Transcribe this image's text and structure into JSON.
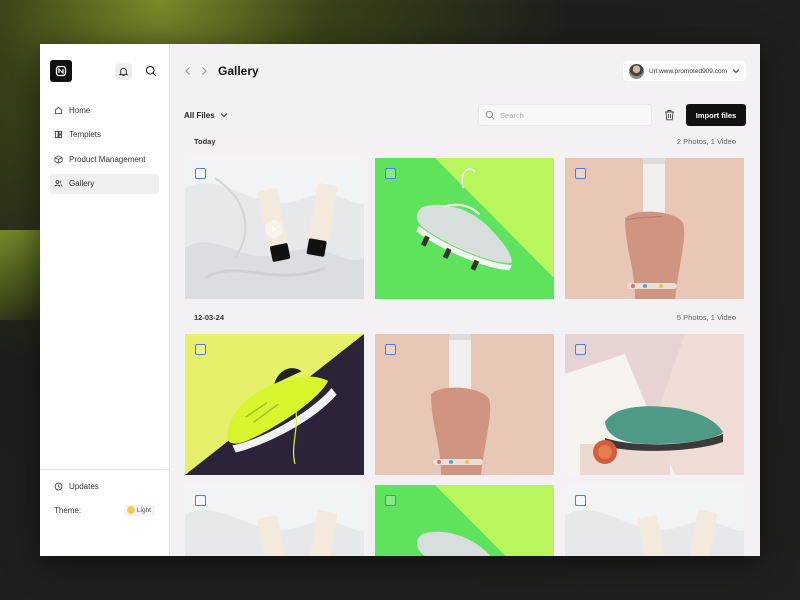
{
  "sidebar": {
    "items": [
      {
        "label": "Home",
        "icon": "home-icon"
      },
      {
        "label": "Templets",
        "icon": "template-icon"
      },
      {
        "label": "Product Management",
        "icon": "package-icon"
      },
      {
        "label": "Gallery",
        "icon": "users-icon",
        "active": true
      }
    ],
    "updates_label": "Updates",
    "theme_label": "Theme:",
    "theme_value": "Light"
  },
  "header": {
    "title": "Gallery",
    "user_url": "Url:www.promoted909.com"
  },
  "toolbar": {
    "filter_label": "All Files",
    "search_placeholder": "Search",
    "import_label": "Import files"
  },
  "sections": [
    {
      "date": "Today",
      "count": "2 Photos, 1 Video"
    },
    {
      "date": "12-03-24",
      "count": "5 Photos, 1 Video"
    }
  ],
  "colors": {
    "accent": "#111111",
    "checkbox": "#4d7cf0",
    "green_bg": "#b8f35a",
    "peach_bg": "#e9c3b2"
  }
}
